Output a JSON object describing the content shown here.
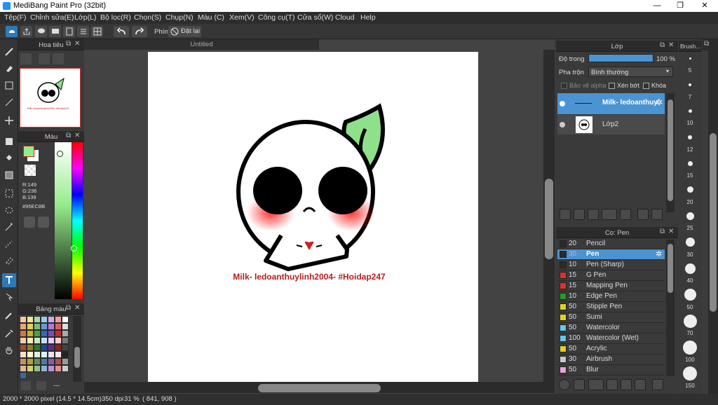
{
  "window": {
    "title": "MediBang Paint Pro (32bit)",
    "minimize": "—",
    "maximize": "❐",
    "close": "✕"
  },
  "menu": [
    "Tệp(F)",
    "Chỉnh sửa(E)",
    "Lớp(L)",
    "Bộ lọc(R)",
    "Chọn(S)",
    "Chụp(N)",
    "Màu (C)",
    "Xem(V)",
    "Công cụ(T)",
    "Cửa sổ(W)",
    "Cloud",
    "Help"
  ],
  "toolbar": {
    "phim_label": "Phím",
    "reset_label": "Đặt lại"
  },
  "navigator": {
    "title": "Hoa tiêu"
  },
  "color_panel": {
    "title": "Màu",
    "r": "R:149",
    "g": "G:236",
    "b": "B:139",
    "hex": "#95EC8B",
    "fg": "#95EC8B"
  },
  "palette": {
    "title": "Bảng màu",
    "footer": "---"
  },
  "canvas": {
    "tab": "Untitled",
    "artwork_caption": "Milk- ledoanthuylinh2004- #Hoidap247",
    "mini_caption": "Milk- ledoanthuylinh2004- #Hoidap247"
  },
  "layers": {
    "title": "Lớp",
    "opacity_label": "Độ trong",
    "opacity_value": "100 %",
    "blend_label": "Pha trộn",
    "blend_value": "Bình thường",
    "protect_alpha": "Bảo vệ alpha",
    "clip": "Xén bớt",
    "lock": "Khóa",
    "items": [
      {
        "name": "Milk- ledoanthuylinh2004- #Hoidap247",
        "selected": true
      },
      {
        "name": "Lớp2",
        "selected": false
      }
    ]
  },
  "brush_list": {
    "title": "Cọ: Pen",
    "items": [
      {
        "size": "20",
        "name": "Pencil",
        "color": "#2a2a2a"
      },
      {
        "size": "30",
        "name": "Pen",
        "color": "#2a2a2a",
        "selected": true
      },
      {
        "size": "10",
        "name": "Pen (Sharp)",
        "color": "#2a2a2a"
      },
      {
        "size": "15",
        "name": "G Pen",
        "color": "#e03030"
      },
      {
        "size": "15",
        "name": "Mapping Pen",
        "color": "#e03030"
      },
      {
        "size": "10",
        "name": "Edge Pen",
        "color": "#20a020"
      },
      {
        "size": "50",
        "name": "Stipple Pen",
        "color": "#e0d020"
      },
      {
        "size": "50",
        "name": "Sumi",
        "color": "#e0d020"
      },
      {
        "size": "50",
        "name": "Watercolor",
        "color": "#60c8e8"
      },
      {
        "size": "100",
        "name": "Watercolor (Wet)",
        "color": "#60c8e8"
      },
      {
        "size": "50",
        "name": "Acrylic",
        "color": "#e0d020"
      },
      {
        "size": "30",
        "name": "Airbrush",
        "color": "#c8c8c8"
      },
      {
        "size": "50",
        "name": "Blur",
        "color": "#f0a0e0"
      }
    ]
  },
  "brush_size": {
    "title": "Brush...",
    "sizes": [
      "5",
      "7",
      "10",
      "12",
      "15",
      "20",
      "25",
      "30",
      "40",
      "50",
      "70",
      "100",
      "150"
    ]
  },
  "status": {
    "size": "2000 * 2000 pixel",
    "physical": "(14.5 * 14.5cm)",
    "dpi": "350 dpi",
    "zoom": "31 %",
    "coords": "( 841, 908 )"
  }
}
